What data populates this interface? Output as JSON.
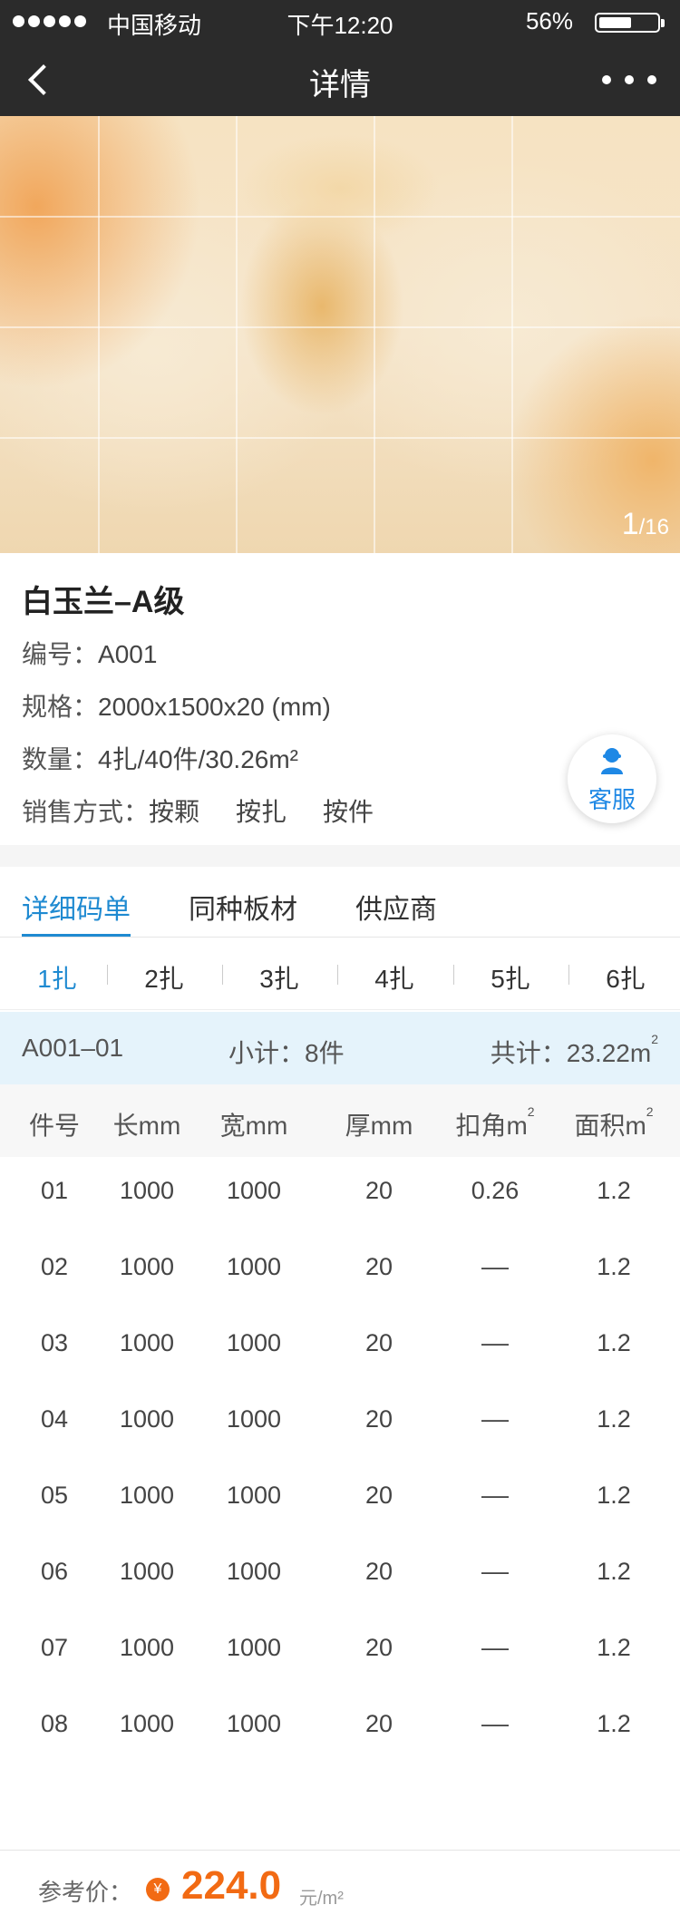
{
  "status_bar": {
    "carrier": "中国移动",
    "time": "下午12:20",
    "battery": "56%",
    "battery_level": 0.56
  },
  "nav": {
    "title": "详情"
  },
  "hero": {
    "current": "1",
    "total": "/16"
  },
  "product": {
    "name": "白玉兰–A级",
    "code_label": "编号：",
    "code": "A001",
    "spec_label": "规格：",
    "spec": "2000x1500x20 (mm)",
    "qty_label": "数量：",
    "qty": "4扎/40件/30.26m²",
    "sale_label": "销售方式：",
    "sale_options": [
      "按颗",
      "按扎",
      "按件"
    ]
  },
  "service": {
    "label": "客服",
    "color": "#1e88e5"
  },
  "tabs": [
    {
      "label": "详细码单",
      "active": true
    },
    {
      "label": "同种板材",
      "active": false
    },
    {
      "label": "供应商",
      "active": false
    }
  ],
  "bundles": [
    "1扎",
    "2扎",
    "3扎",
    "4扎",
    "5扎",
    "6扎"
  ],
  "summary": {
    "code": "A001–01",
    "subtotal": "小计：8件",
    "total_label": "共计：23.22m",
    "total_sup": "2"
  },
  "table": {
    "headers": [
      {
        "text": "件号",
        "sup": ""
      },
      {
        "text": "长mm",
        "sup": ""
      },
      {
        "text": "宽mm",
        "sup": ""
      },
      {
        "text": "厚mm",
        "sup": ""
      },
      {
        "text": "扣角m",
        "sup": "2"
      },
      {
        "text": "面积m",
        "sup": "2"
      }
    ],
    "rows": [
      [
        "01",
        "1000",
        "1000",
        "20",
        "0.26",
        "1.2"
      ],
      [
        "02",
        "1000",
        "1000",
        "20",
        "––",
        "1.2"
      ],
      [
        "03",
        "1000",
        "1000",
        "20",
        "––",
        "1.2"
      ],
      [
        "04",
        "1000",
        "1000",
        "20",
        "––",
        "1.2"
      ],
      [
        "05",
        "1000",
        "1000",
        "20",
        "––",
        "1.2"
      ],
      [
        "06",
        "1000",
        "1000",
        "20",
        "––",
        "1.2"
      ],
      [
        "07",
        "1000",
        "1000",
        "20",
        "––",
        "1.2"
      ],
      [
        "08",
        "1000",
        "1000",
        "20",
        "––",
        "1.2"
      ]
    ]
  },
  "footer": {
    "ref_label": "参考价：",
    "currency_icon": "¥",
    "price": "224.0",
    "unit": "元/m²",
    "price_color": "#f26a13"
  },
  "colors": {
    "accent": "#1f8ad1",
    "topbar": "#2b2b2b",
    "summary_bg": "#e5f3fb"
  }
}
